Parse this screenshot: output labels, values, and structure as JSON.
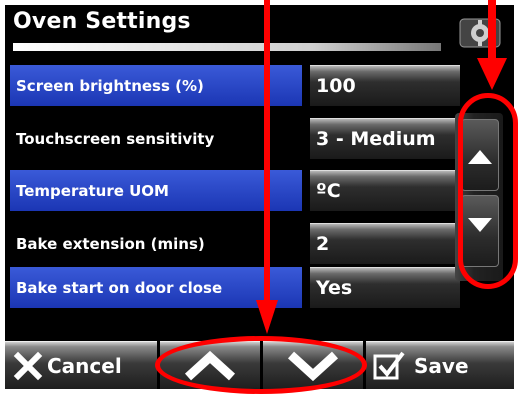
{
  "screen": {
    "title": "Oven Settings"
  },
  "settings": [
    {
      "label": "Screen brightness (%)",
      "value": "100"
    },
    {
      "label": "Touchscreen sensitivity",
      "value": "3 - Medium"
    },
    {
      "label": "Temperature UOM",
      "value": "ºC"
    },
    {
      "label": "Bake extension (mins)",
      "value": "2"
    },
    {
      "label": "Bake start on door close",
      "value": "Yes"
    }
  ],
  "toolbar": {
    "cancel_label": "Cancel",
    "save_label": "Save"
  },
  "icons": {
    "settings": "settings-icon",
    "page_up": "triangle-up-icon",
    "page_down": "triangle-down-icon",
    "row_up": "chevron-up-icon",
    "row_down": "chevron-down-icon",
    "cancel": "x-icon",
    "save": "checkmark-icon"
  },
  "colors": {
    "row_highlight": "#2a46c4",
    "annotation": "#ff0000",
    "background": "#000000"
  }
}
